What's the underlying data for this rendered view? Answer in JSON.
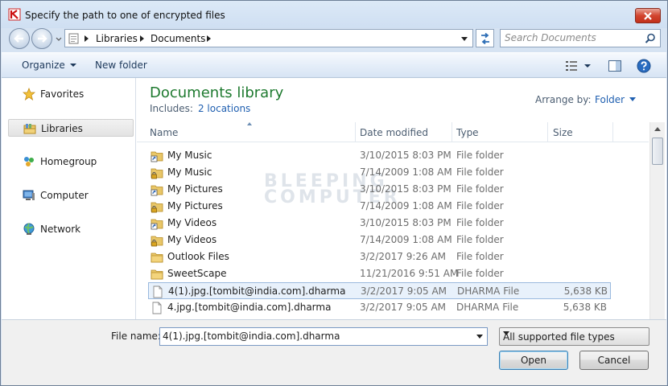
{
  "window": {
    "title": "Specify the path to one of encrypted files"
  },
  "address": {
    "crumbs": [
      "Libraries",
      "Documents"
    ]
  },
  "search": {
    "placeholder": "Search Documents"
  },
  "toolbar": {
    "organize_label": "Organize",
    "new_folder_label": "New folder"
  },
  "sidebar": {
    "items": [
      {
        "label": "Favorites",
        "icon": "star-icon"
      },
      {
        "label": "Libraries",
        "icon": "libraries-icon",
        "selected": true
      },
      {
        "label": "Homegroup",
        "icon": "homegroup-icon"
      },
      {
        "label": "Computer",
        "icon": "computer-icon"
      },
      {
        "label": "Network",
        "icon": "network-icon"
      }
    ]
  },
  "library": {
    "title": "Documents library",
    "includes_label": "Includes:",
    "includes_link": "2 locations",
    "arrange_label": "Arrange by:",
    "arrange_value": "Folder"
  },
  "columns": {
    "name": "Name",
    "date": "Date modified",
    "type": "Type",
    "size": "Size"
  },
  "files": [
    {
      "name": "My Music",
      "date": "3/10/2015 8:03 PM",
      "type": "File folder",
      "size": "",
      "icon": "shortcut-folder-icon"
    },
    {
      "name": "My Music",
      "date": "7/14/2009 1:08 AM",
      "type": "File folder",
      "size": "",
      "icon": "locked-folder-icon"
    },
    {
      "name": "My Pictures",
      "date": "3/10/2015 8:03 PM",
      "type": "File folder",
      "size": "",
      "icon": "shortcut-folder-icon"
    },
    {
      "name": "My Pictures",
      "date": "7/14/2009 1:08 AM",
      "type": "File folder",
      "size": "",
      "icon": "locked-folder-icon"
    },
    {
      "name": "My Videos",
      "date": "3/10/2015 8:03 PM",
      "type": "File folder",
      "size": "",
      "icon": "shortcut-folder-icon"
    },
    {
      "name": "My Videos",
      "date": "7/14/2009 1:08 AM",
      "type": "File folder",
      "size": "",
      "icon": "locked-folder-icon"
    },
    {
      "name": "Outlook Files",
      "date": "3/2/2017 9:26 AM",
      "type": "File folder",
      "size": "",
      "icon": "folder-icon"
    },
    {
      "name": "SweetScape",
      "date": "11/21/2016 9:51 AM",
      "type": "File folder",
      "size": "",
      "icon": "folder-icon"
    },
    {
      "name": "4(1).jpg.[tombit@india.com].dharma",
      "date": "3/2/2017 9:05 AM",
      "type": "DHARMA File",
      "size": "5,638 KB",
      "icon": "file-icon",
      "selected": true
    },
    {
      "name": "4.jpg.[tombit@india.com].dharma",
      "date": "3/2/2017 9:05 AM",
      "type": "DHARMA File",
      "size": "5,638 KB",
      "icon": "file-icon"
    }
  ],
  "watermark": {
    "line1": "BLEEPING",
    "line2": "COMPUTER"
  },
  "footer": {
    "file_name_label": "File name:",
    "file_name_value": "4(1).jpg.[tombit@india.com].dharma",
    "file_type_value": "All supported file types",
    "open_label": "Open",
    "cancel_label": "Cancel"
  },
  "colors": {
    "library_title": "#1e7a2f",
    "link": "#1f5fb0",
    "selection_bg": "#e8f1fb",
    "selection_border": "#9ab9de",
    "close_button": "#c2301b"
  }
}
